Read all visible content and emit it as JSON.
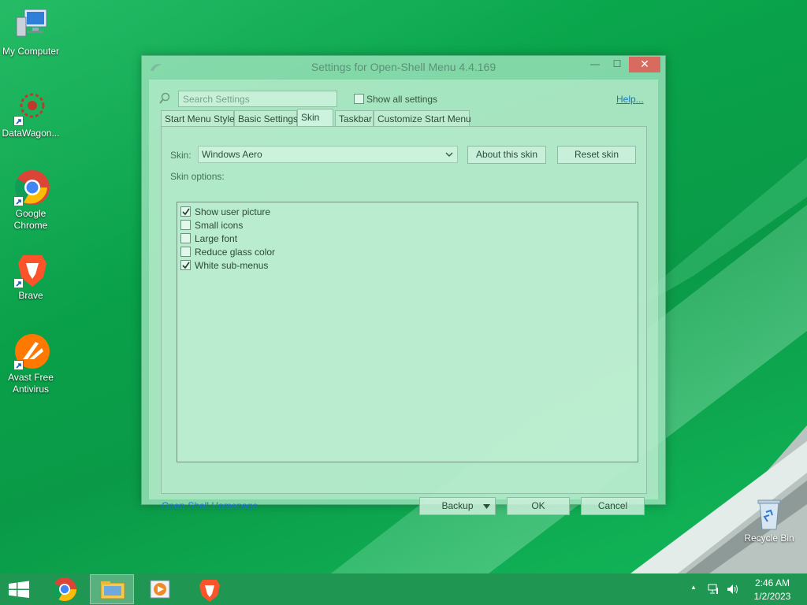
{
  "desktop": {
    "icons": [
      {
        "label": "My Computer",
        "icon": "computer-icon"
      },
      {
        "label": "DataWagon...",
        "icon": "datawagon-icon"
      },
      {
        "label": "Google Chrome",
        "icon": "chrome-icon"
      },
      {
        "label": "Brave",
        "icon": "brave-icon"
      },
      {
        "label": "Avast Free Antivirus",
        "icon": "avast-icon"
      },
      {
        "label": "Recycle Bin",
        "icon": "recycle-bin-icon"
      }
    ]
  },
  "dialog": {
    "title": "Settings for Open-Shell Menu 4.4.169",
    "close_glyph": "✕",
    "min_glyph": "—",
    "max_glyph": "☐",
    "search_placeholder": "Search Settings",
    "show_all_label": "Show all settings",
    "show_all_checked": false,
    "help_link": "Help...",
    "tabs": [
      {
        "label": "Start Menu Style",
        "active": false
      },
      {
        "label": "Basic Settings",
        "active": false
      },
      {
        "label": "Skin",
        "active": true
      },
      {
        "label": "Taskbar",
        "active": false
      },
      {
        "label": "Customize Start Menu",
        "active": false
      }
    ],
    "skin_label": "Skin:",
    "skin_value": "Windows Aero",
    "about_skin_button": "About this skin",
    "reset_skin_button": "Reset skin",
    "skin_options_label": "Skin options:",
    "options": [
      {
        "label": "Show user picture",
        "checked": true
      },
      {
        "label": "Small icons",
        "checked": false
      },
      {
        "label": "Large font",
        "checked": false
      },
      {
        "label": "Reduce glass color",
        "checked": false
      },
      {
        "label": "White sub-menus",
        "checked": true
      }
    ],
    "homepage_link": "Open-Shell Homepage",
    "backup_button": "Backup",
    "ok_button": "OK",
    "cancel_button": "Cancel"
  },
  "taskbar": {
    "items": [
      "start-icon",
      "chrome-icon",
      "file-explorer-icon",
      "media-player-icon",
      "brave-icon"
    ],
    "active_item": "file-explorer-icon",
    "clock_time": "2:46 AM",
    "clock_date": "1/2/2023",
    "tray_overflow_glyph": "▲"
  },
  "colors": {
    "desktop_green": "#0a9e46",
    "link_blue": "#1b74c7",
    "close_red": "#d76b5f"
  }
}
